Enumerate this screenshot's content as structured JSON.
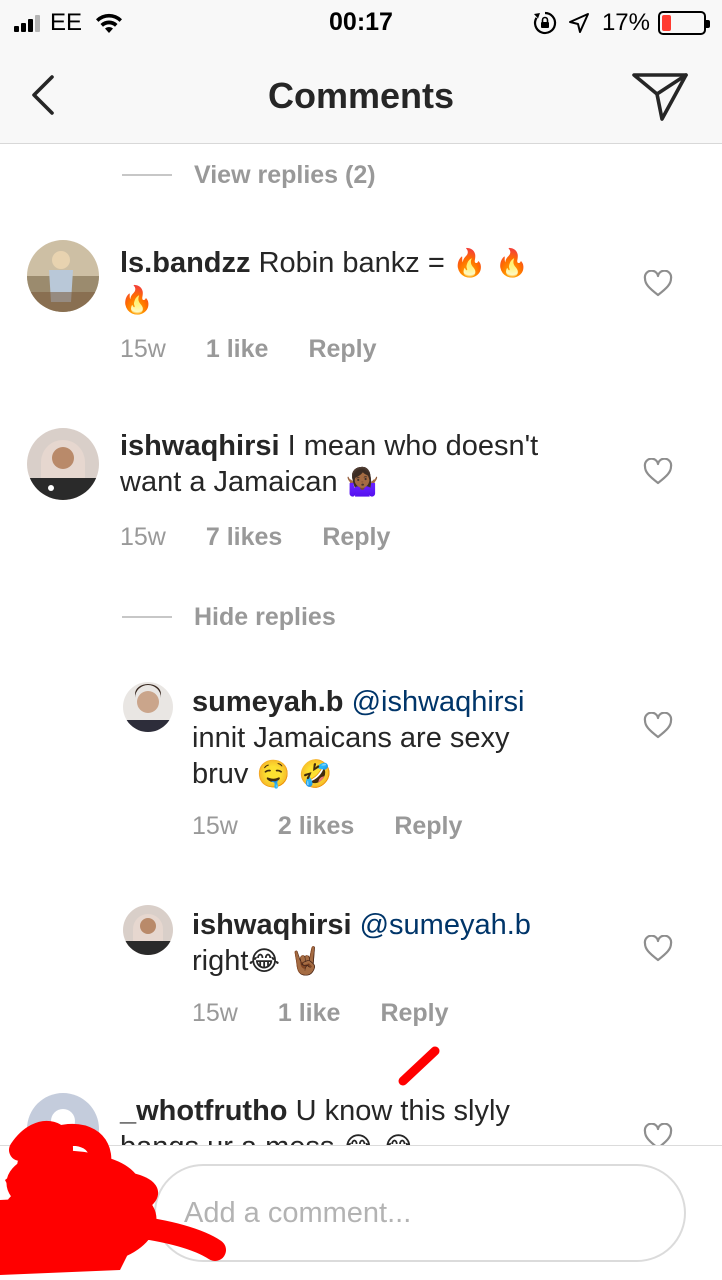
{
  "status_bar": {
    "carrier": "EE",
    "time": "00:17",
    "battery_percent": "17%",
    "battery_level": 0.17,
    "icons": [
      "signal-icon",
      "wifi-icon",
      "rotation-lock-icon",
      "location-arrow-icon",
      "battery-icon"
    ]
  },
  "header": {
    "title": "Comments",
    "back_icon": "chevron-left-icon",
    "share_icon": "paper-plane-icon"
  },
  "toggles": {
    "view_replies": "View replies (2)",
    "hide_replies": "Hide replies"
  },
  "comments": [
    {
      "username": "ls.bandzz",
      "mention": "",
      "text_line1": " Robin bankz = ",
      "emoji_line1": "🔥 🔥",
      "text_line2": "",
      "emoji_line2": "🔥",
      "time": "15w",
      "likes": "1 like",
      "reply": "Reply"
    },
    {
      "username": "ishwaqhirsi",
      "mention": "",
      "text_line1": " I mean who doesn't",
      "text_line2": "want a Jamaican ",
      "emoji_line2": "🤷🏾‍♀️",
      "time": "15w",
      "likes": "7 likes",
      "reply": "Reply"
    },
    {
      "username": "sumeyah.b",
      "mention": "@ishwaqhirsi",
      "text_line2": "innit Jamaicans are sexy",
      "text_line3": "bruv ",
      "emoji_line3": "🤤 🤣",
      "time": "15w",
      "likes": "2 likes",
      "reply": "Reply"
    },
    {
      "username": "ishwaqhirsi",
      "mention": "@sumeyah.b",
      "text_line2": "right",
      "emoji_line2": "😂 🤘🏾",
      "time": "15w",
      "likes": "1 like",
      "reply": "Reply"
    },
    {
      "username": "_whotfrutho",
      "text_line1": " U know this slyly",
      "text_line2": "bangs ur a mess ",
      "emoji_line2": "😂 😂"
    }
  ],
  "composer": {
    "placeholder": "Add a comment..."
  },
  "colors": {
    "header_bg": "#f8f8f8",
    "text": "#262626",
    "muted": "#999999",
    "mention": "#003569",
    "scribble": "#ff0000"
  }
}
